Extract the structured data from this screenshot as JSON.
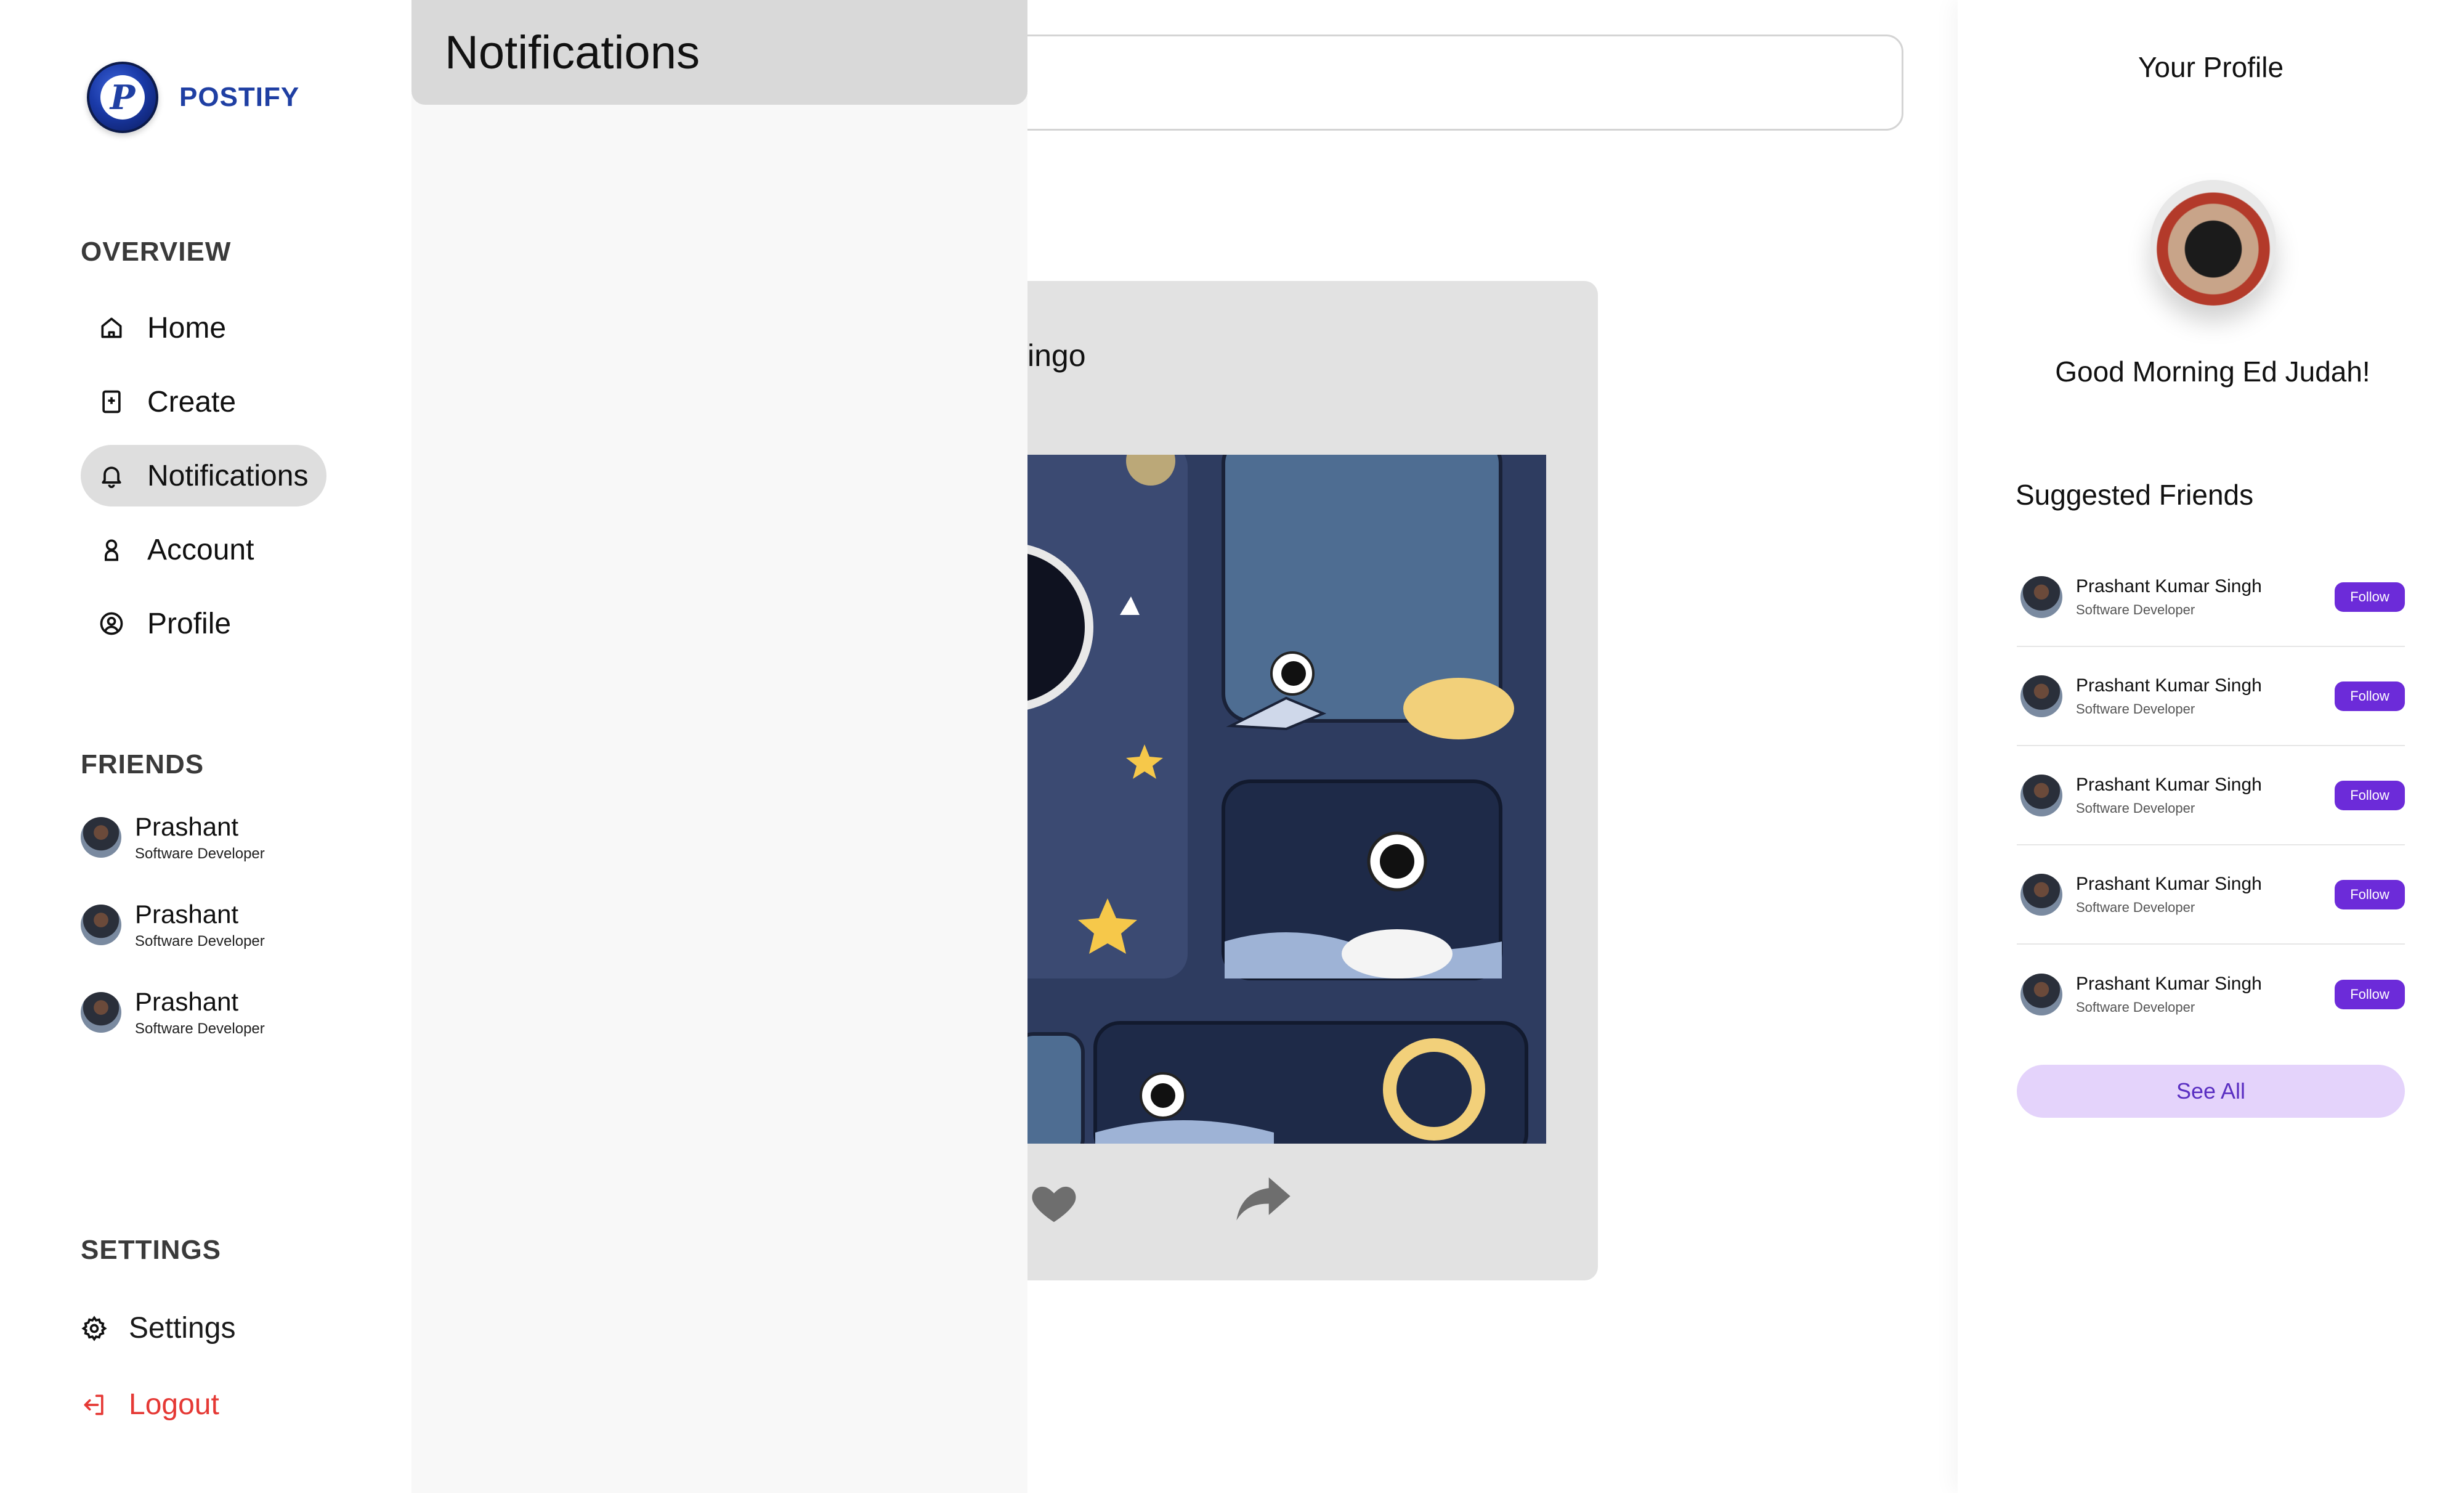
{
  "brand": {
    "name": "POSTIFY",
    "logo_letter": "P"
  },
  "sidebar": {
    "overview_title": "OVERVIEW",
    "nav": [
      {
        "label": "Home",
        "icon": "home-icon"
      },
      {
        "label": "Create",
        "icon": "create-icon"
      },
      {
        "label": "Notifications",
        "icon": "bell-icon",
        "active": true
      },
      {
        "label": "Account",
        "icon": "user-icon"
      },
      {
        "label": "Profile",
        "icon": "profile-circle-icon"
      }
    ],
    "friends_title": "FRIENDS",
    "friends": [
      {
        "name": "Prashant",
        "role": "Software Developer"
      },
      {
        "name": "Prashant",
        "role": "Software Developer"
      },
      {
        "name": "Prashant",
        "role": "Software Developer"
      }
    ],
    "settings_title": "SETTINGS",
    "settings_label": "Settings",
    "logout_label": "Logout"
  },
  "notifications": {
    "title": "Notifications"
  },
  "post": {
    "author_fragment": "ingo"
  },
  "right_panel": {
    "title": "Your Profile",
    "greeting": "Good Morning Ed Judah!",
    "suggested_title": "Suggested Friends",
    "suggestions": [
      {
        "name": "Prashant Kumar Singh",
        "role": "Software Developer",
        "button": "Follow"
      },
      {
        "name": "Prashant Kumar Singh",
        "role": "Software Developer",
        "button": "Follow"
      },
      {
        "name": "Prashant Kumar Singh",
        "role": "Software Developer",
        "button": "Follow"
      },
      {
        "name": "Prashant Kumar Singh",
        "role": "Software Developer",
        "button": "Follow"
      },
      {
        "name": "Prashant Kumar Singh",
        "role": "Software Developer",
        "button": "Follow"
      }
    ],
    "see_all": "See All"
  },
  "colors": {
    "brand": "#1f3fa3",
    "active_nav": "#dedede",
    "logout": "#e53935",
    "follow_button": "#6c2bd9",
    "see_all_bg": "#e4d3fb"
  }
}
